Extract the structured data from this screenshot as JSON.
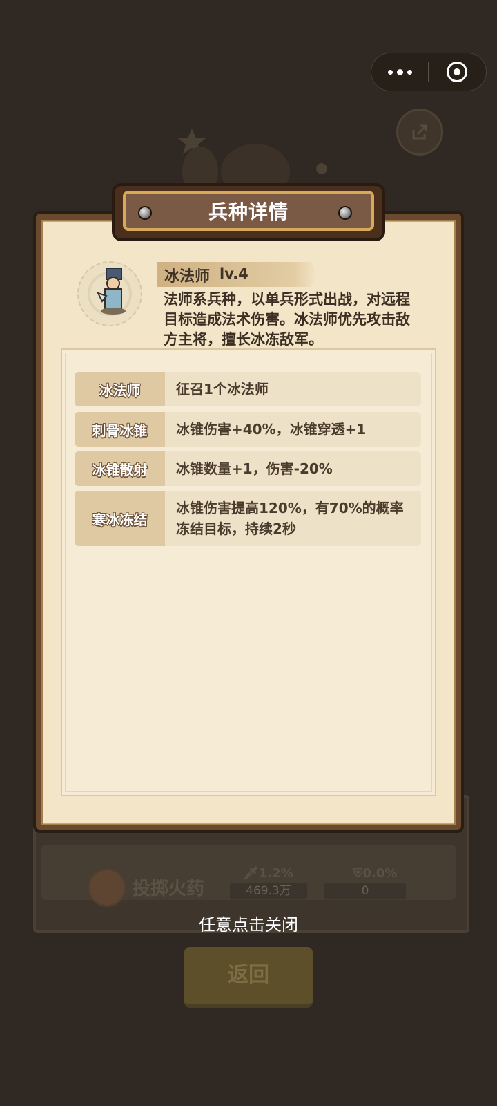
{
  "capsule": {
    "more_icon": "more-dots-icon",
    "close_icon": "target-circle-icon"
  },
  "background": {
    "skill_name": "投掷火药",
    "stat1_label": "🗡1.2%",
    "stat1_value": "469.3万",
    "stat2_label": "⛨0.0%",
    "stat2_value": "0",
    "back_label": "返回"
  },
  "modal": {
    "title": "兵种详情",
    "hero": {
      "name": "冰法师",
      "level": "lv.4",
      "description": "法师系兵种，以单兵形式出战，对远程目标造成法术伤害。冰法师优先攻击敌方主将，擅长冰冻敌军。"
    },
    "skills": [
      {
        "name": "冰法师",
        "desc": "征召1个冰法师"
      },
      {
        "name": "刺骨冰锥",
        "desc": "冰锥伤害+40%，冰锥穿透+1"
      },
      {
        "name": "冰锥散射",
        "desc": "冰锥数量+1，伤害-20%"
      },
      {
        "name": "寒冰冻结",
        "desc": "冰锥伤害提高120%，有70%的概率冻结目标，持续2秒"
      }
    ]
  },
  "close_hint": "任意点击关闭"
}
